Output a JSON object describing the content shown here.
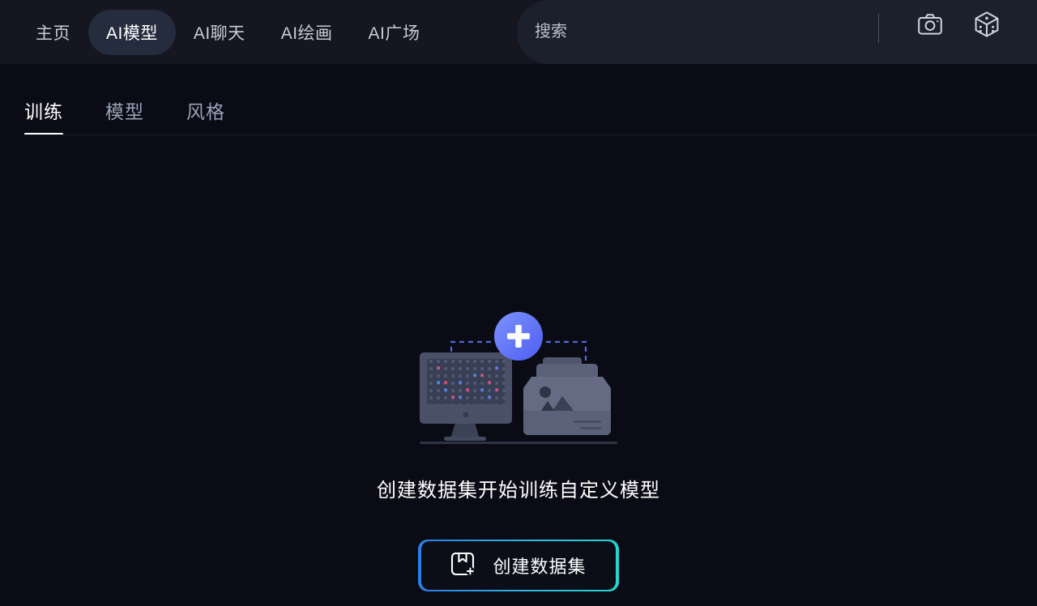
{
  "header": {
    "nav": [
      {
        "label": "主页",
        "active": false,
        "name": "nav-item-home"
      },
      {
        "label": "AI模型",
        "active": true,
        "name": "nav-item-ai-model"
      },
      {
        "label": "AI聊天",
        "active": false,
        "name": "nav-item-ai-chat"
      },
      {
        "label": "AI绘画",
        "active": false,
        "name": "nav-item-ai-paint"
      },
      {
        "label": "AI广场",
        "active": false,
        "name": "nav-item-ai-plaza"
      }
    ],
    "search": {
      "value": "",
      "placeholder": "搜索",
      "camera_icon": "camera-icon",
      "dice_icon": "dice-icon"
    }
  },
  "subtabs": [
    {
      "label": "训练",
      "active": true,
      "name": "tab-training"
    },
    {
      "label": "模型",
      "active": false,
      "name": "tab-models"
    },
    {
      "label": "风格",
      "active": false,
      "name": "tab-styles"
    }
  ],
  "empty_state": {
    "illustration_name": "create-dataset-illustration",
    "message": "创建数据集开始训练自定义模型",
    "button_label": "创建数据集",
    "button_icon": "add-dataset-icon"
  },
  "colors": {
    "page_background": "#0a0b14",
    "header_background": "#15161f",
    "search_background": "#1c1f2c",
    "active_pill": "#252c3d",
    "accent_blue": "#2b7de9",
    "accent_cyan": "#22d8d2",
    "plus_circle": "#5b6ef5",
    "text_primary": "#ffffff",
    "text_muted": "#9aa3b8"
  }
}
